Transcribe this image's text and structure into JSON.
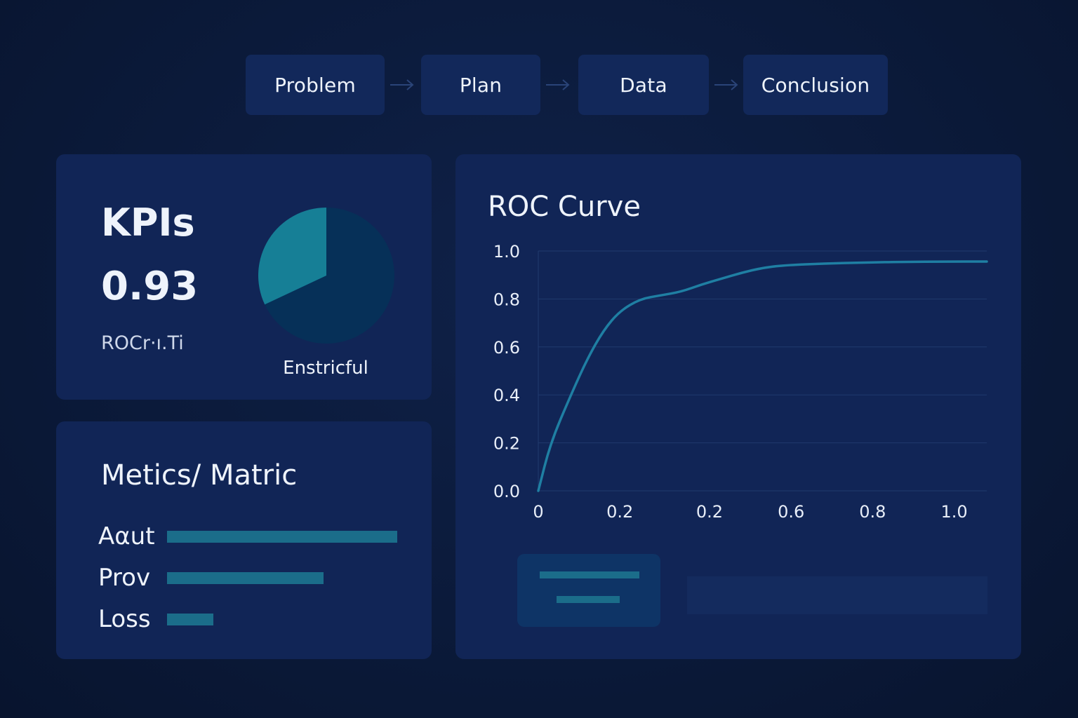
{
  "pipeline": {
    "steps": [
      "Problem",
      "Plan",
      "Data",
      "Conclusion"
    ]
  },
  "kpi_card": {
    "title": "KPIs",
    "value": "0.93",
    "subtitle": "ROCr·ı.Ti",
    "pie_label": "Enstricful"
  },
  "metrics_card": {
    "title": "Metics/ Matric",
    "rows": [
      {
        "label": "Aαut",
        "value": 1.0
      },
      {
        "label": "Prov",
        "value": 0.68
      },
      {
        "label": "Loss",
        "value": 0.2
      }
    ]
  },
  "roc_card": {
    "title": "ROC Curve"
  },
  "colors": {
    "background": "#0b1a3a",
    "card": "#112556",
    "accent": "#1b6d8a",
    "curve": "#1f7fa3",
    "pie_light": "#167f96",
    "pie_dark": "#063058"
  },
  "chart_data": [
    {
      "type": "pie",
      "title": "",
      "slices": [
        {
          "label": "",
          "value": 0.32,
          "color": "#167f96"
        },
        {
          "label": "",
          "value": 0.68,
          "color": "#063058"
        }
      ]
    },
    {
      "type": "line",
      "title": "ROC Curve",
      "xlabel": "",
      "ylabel": "",
      "x_ticks": [
        "0",
        "0.2",
        "0.2",
        "0.6",
        "0.8",
        "1.0"
      ],
      "y_ticks": [
        "0.0",
        "0.2",
        "0.4",
        "0.6",
        "0.8",
        "1.0"
      ],
      "xlim": [
        0,
        1.1
      ],
      "ylim": [
        0,
        1.0
      ],
      "grid": true,
      "series": [
        {
          "x": [
            0,
            0.03,
            0.08,
            0.12,
            0.16,
            0.2,
            0.25,
            0.3,
            0.35,
            0.4,
            0.45,
            0.5,
            0.55,
            0.6,
            0.7,
            0.8,
            0.9,
            1.0,
            1.1
          ],
          "y": [
            0.0,
            0.2,
            0.4,
            0.55,
            0.67,
            0.75,
            0.8,
            0.815,
            0.83,
            0.86,
            0.885,
            0.91,
            0.93,
            0.94,
            0.948,
            0.952,
            0.955,
            0.956,
            0.956
          ]
        }
      ]
    }
  ]
}
